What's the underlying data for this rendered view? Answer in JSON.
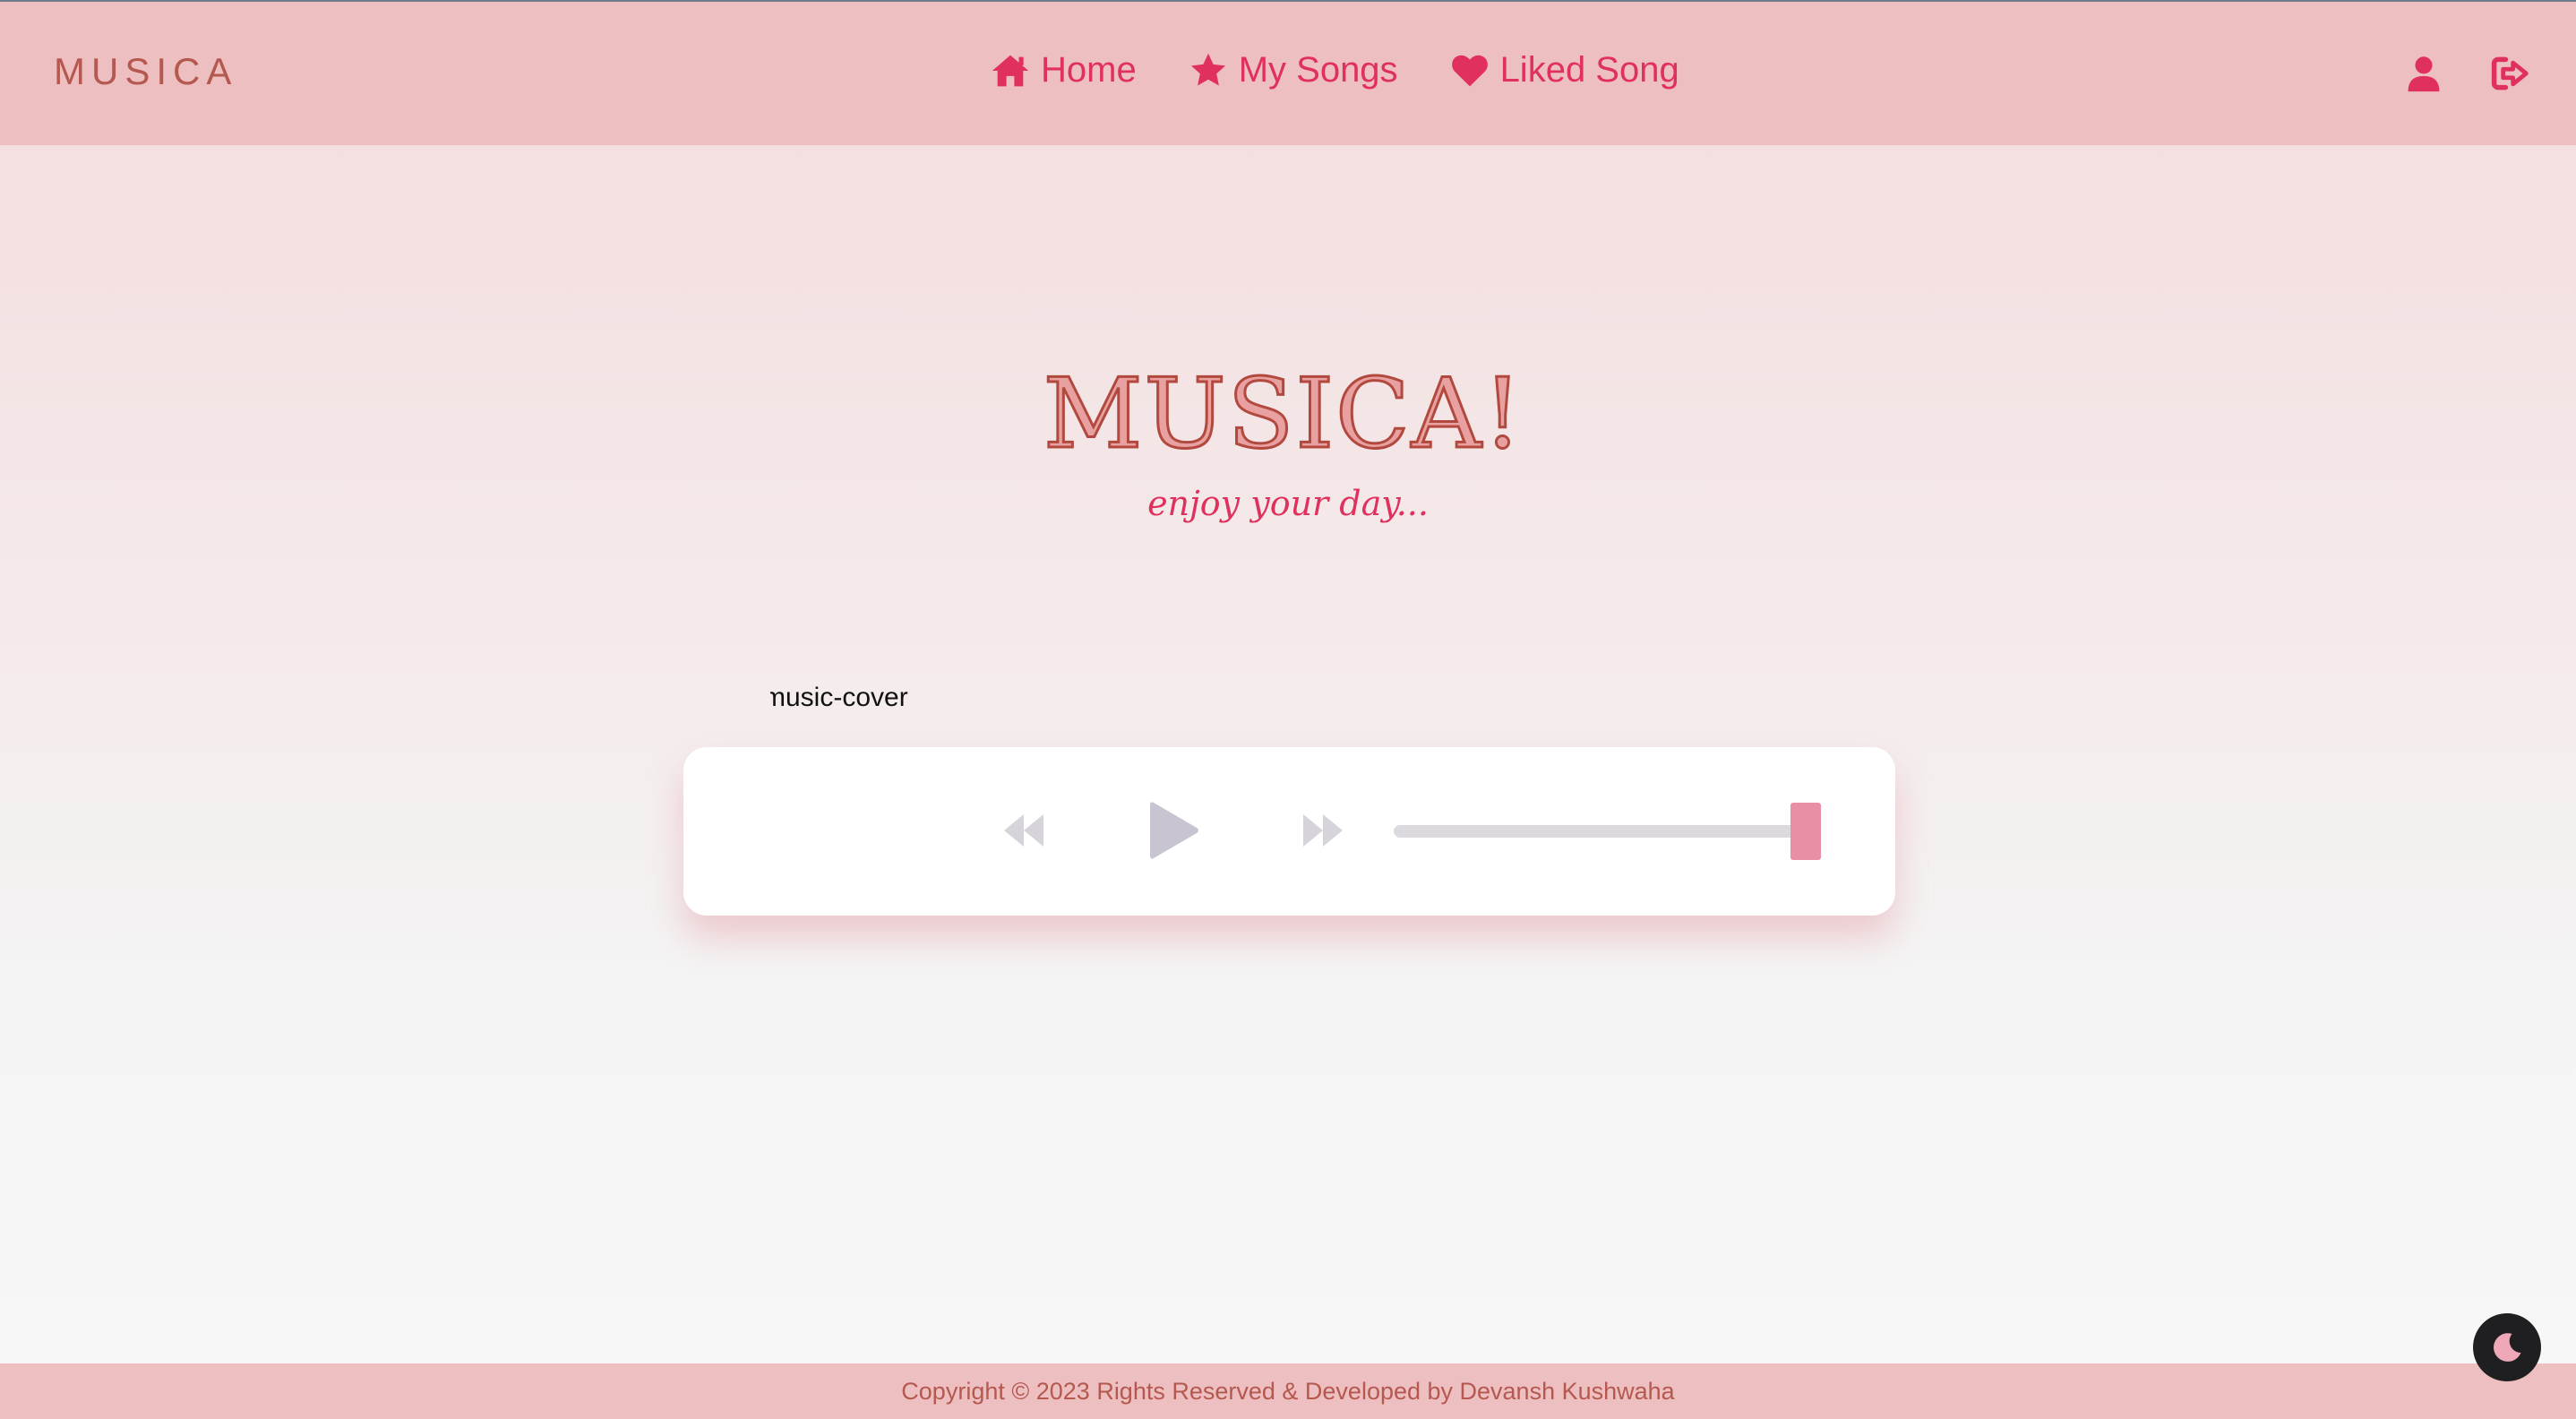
{
  "navbar": {
    "brand": "MUSICA",
    "links": [
      {
        "label": "Home",
        "icon": "home-icon"
      },
      {
        "label": "My Songs",
        "icon": "star-icon"
      },
      {
        "label": "Liked Song",
        "icon": "heart-icon"
      }
    ],
    "right_icons": [
      "user-icon",
      "logout-icon"
    ]
  },
  "hero": {
    "title": "MUSICA!",
    "subtitle": "enjoy your day..."
  },
  "player": {
    "cover_alt": "music-cover",
    "controls": [
      "rewind-icon",
      "play-icon",
      "fast-forward-icon"
    ],
    "progress": 1.0
  },
  "footer": {
    "text": "Copyright © 2023 Rights Reserved & Developed by Devansh Kushwaha"
  },
  "theme_toggle": {
    "icon": "moon-icon"
  },
  "colors": {
    "accent": "#e0305e",
    "brand": "#b5584f",
    "navbar_bg": "#eebfc0",
    "progress_thumb": "#e88fa6",
    "control_icon": "#d6d3da"
  }
}
